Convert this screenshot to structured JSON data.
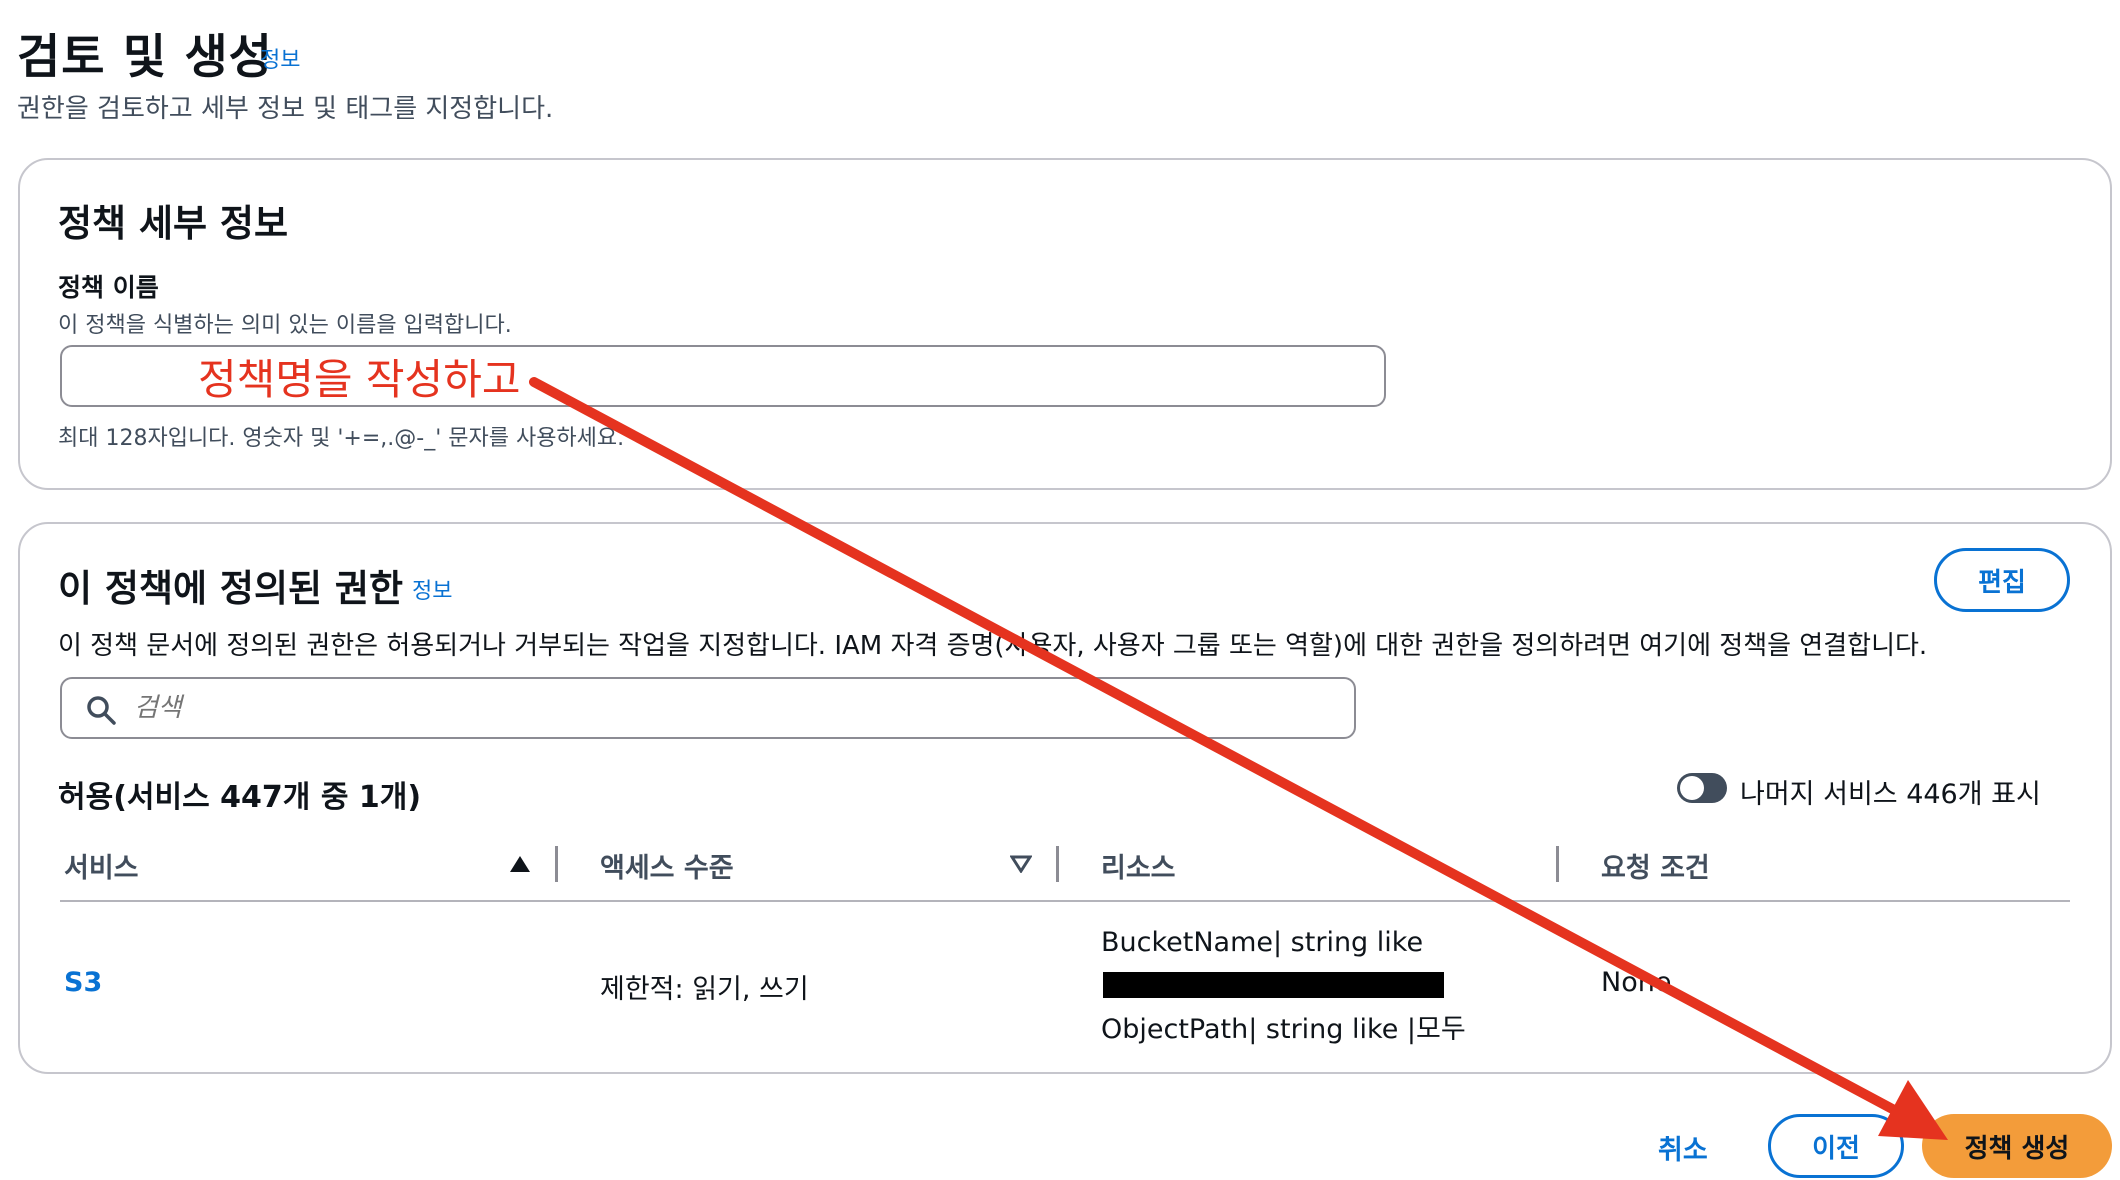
{
  "header": {
    "title": "검토 및 생성",
    "info": "정보",
    "subtitle": "권한을 검토하고 세부 정보 및 태그를 지정합니다."
  },
  "policy_details": {
    "heading": "정책 세부 정보",
    "name_label": "정책 이름",
    "name_desc": "이 정책을 식별하는 의미 있는 이름을 입력합니다.",
    "name_value": "",
    "name_hint": "최대 128자입니다. 영숫자 및 '+=,.@-_' 문자를 사용하세요."
  },
  "annotation": {
    "text": "정책명을 작성하고",
    "color": "#e5331f"
  },
  "permissions": {
    "heading": "이 정책에 정의된 권한",
    "info": "정보",
    "edit_label": "편집",
    "description": "이 정책 문서에 정의된 권한은 허용되거나 거부되는 작업을 지정합니다. IAM 자격 증명(사용자, 사용자 그룹 또는 역할)에 대한 권한을 정의하려면 여기에 정책을 연결합니다.",
    "search_placeholder": "검색",
    "allow_title": "허용(서비스 447개 중 1개)",
    "toggle_label": "나머지 서비스 446개 표시",
    "toggle_on": false,
    "columns": {
      "service": "서비스",
      "access": "액세스 수준",
      "resource": "리소스",
      "condition": "요청 조건"
    },
    "rows": [
      {
        "service": "S3",
        "access": "제한적: 읽기, 쓰기",
        "resource_line1": "BucketName| string like",
        "resource_line3": "ObjectPath| string like |모두",
        "condition": "None"
      }
    ]
  },
  "footer": {
    "cancel": "취소",
    "previous": "이전",
    "create": "정책 생성"
  },
  "colors": {
    "accent": "#0972d3",
    "primary_button": "#f39c3a",
    "annotation_arrow": "#e5331f"
  }
}
